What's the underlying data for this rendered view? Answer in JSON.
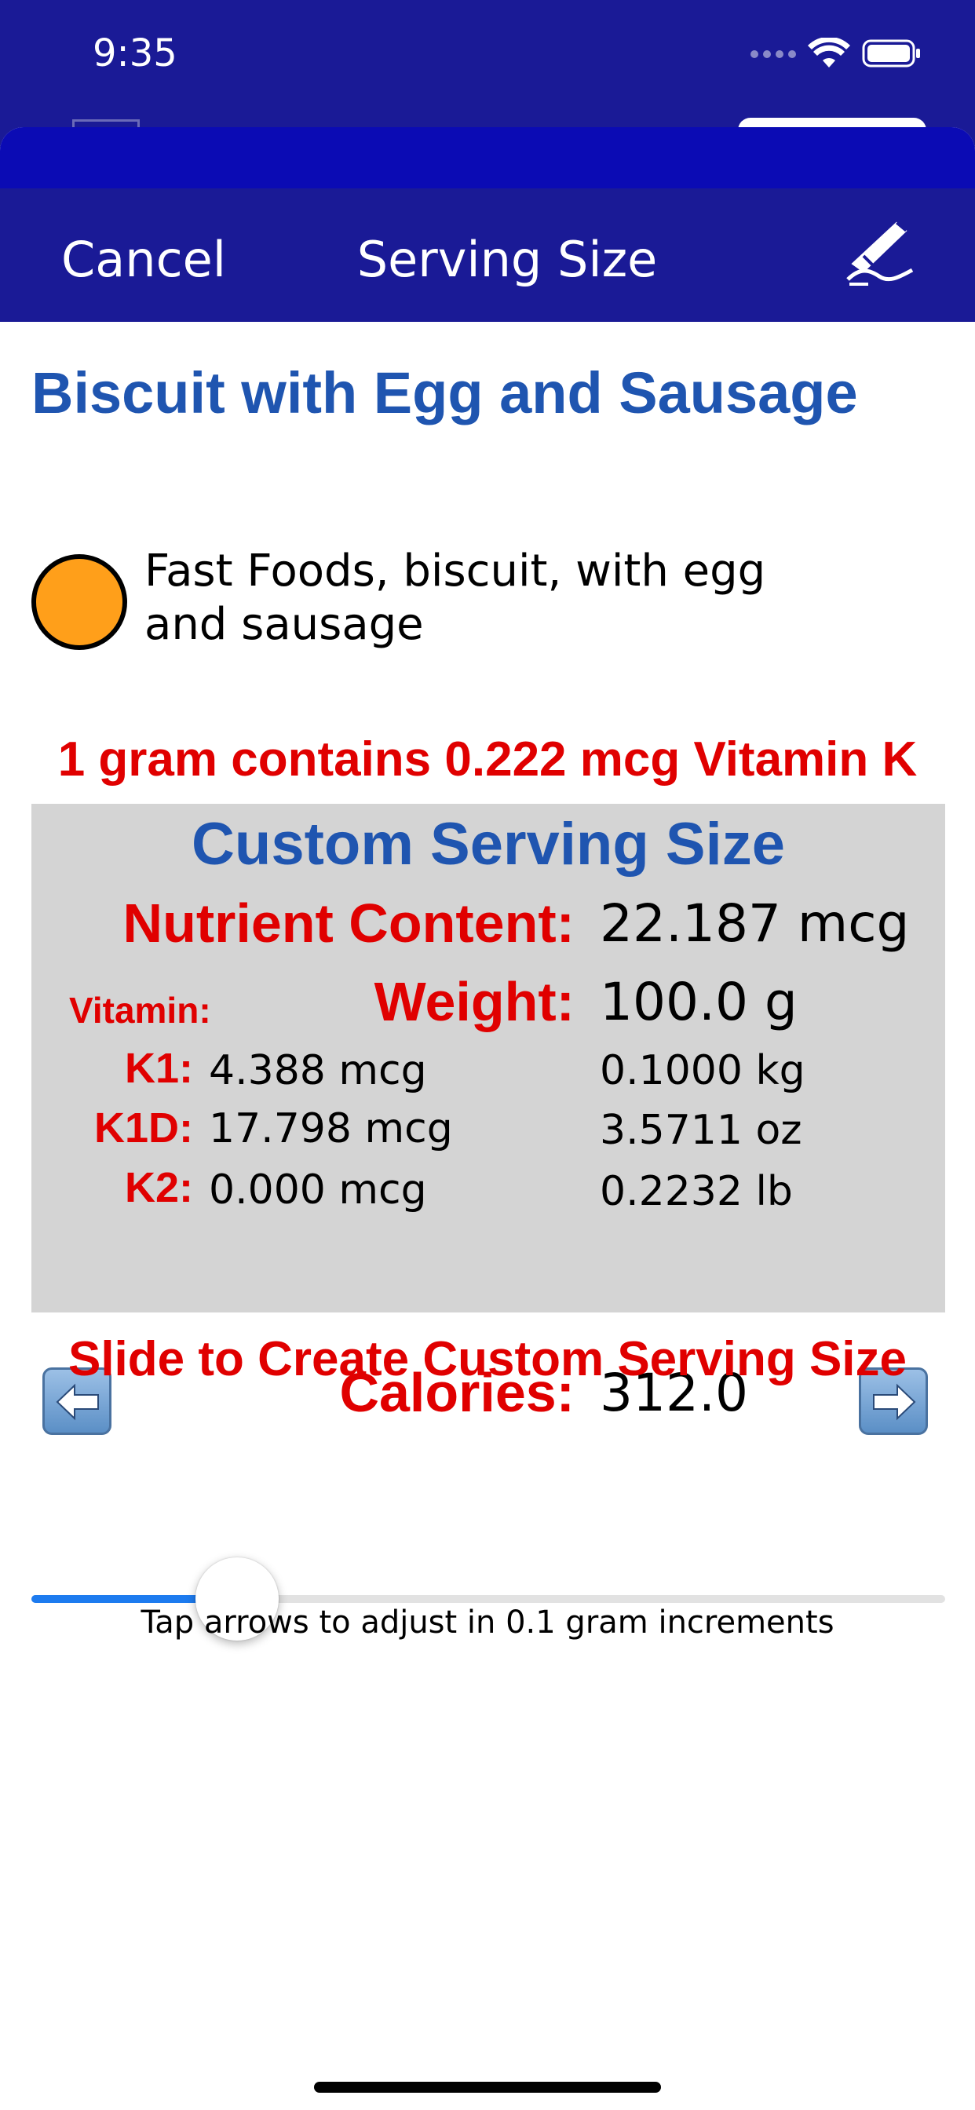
{
  "status_bar": {
    "time": "9:35",
    "wifi_icon": "wifi-icon",
    "battery_icon": "battery-icon"
  },
  "navbar": {
    "cancel_label": "Cancel",
    "title": "Serving Size",
    "tool_icon": "edit-pen-icon"
  },
  "food": {
    "title": "Biscuit with Egg and Sausage",
    "description": "Fast Foods, biscuit, with egg and sausage",
    "indicator_color": "#ff9f1a"
  },
  "ratio_text": "1 gram contains 0.222 mcg Vitamin K",
  "panel": {
    "title": "Custom Serving Size",
    "nutrient_label": "Nutrient Content:",
    "nutrient_value": "22.187 mcg",
    "vitamin_label": "Vitamin:",
    "weight_label": "Weight:",
    "weight_value": "100.0 g",
    "k1_label": "K1:",
    "k1_value": "4.388 mcg",
    "k1d_label": "K1D:",
    "k1d_value": "17.798 mcg",
    "k2_label": "K2:",
    "k2_value": "0.000 mcg",
    "weight_kg": "0.1000 kg",
    "weight_oz": "3.5711 oz",
    "weight_lb": "0.2232 lb",
    "calories_label": "Calories:",
    "calories_value": "312.0",
    "left_arrow_icon": "left-arrow-icon",
    "right_arrow_icon": "right-arrow-icon"
  },
  "slide_hint": "Slide to Create Custom Serving Size",
  "slider": {
    "fraction": 0.225
  },
  "tap_hint": "Tap arrows to adjust in 0.1 gram increments",
  "colors": {
    "nav_bg": "#1a1a96",
    "accent_red": "#e00000",
    "title_blue": "#1f55b0",
    "panel_bg": "#d4d4d4",
    "slider_blue": "#1d7bef"
  }
}
